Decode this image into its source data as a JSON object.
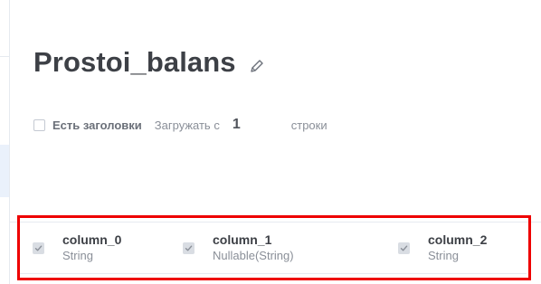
{
  "page": {
    "title": "Prostoi_balans"
  },
  "options": {
    "has_headers_label": "Есть заголовки",
    "load_from_label": "Загружать с",
    "load_from_row": "1",
    "rows_label": "строки"
  },
  "columns": [
    {
      "name": "column_0",
      "type": "String"
    },
    {
      "name": "column_1",
      "type": "Nullable(String)"
    },
    {
      "name": "column_2",
      "type": "String"
    }
  ],
  "colors": {
    "highlight": "#ee0000",
    "text_dark": "#3d4046",
    "text_muted": "#8a8f98"
  }
}
